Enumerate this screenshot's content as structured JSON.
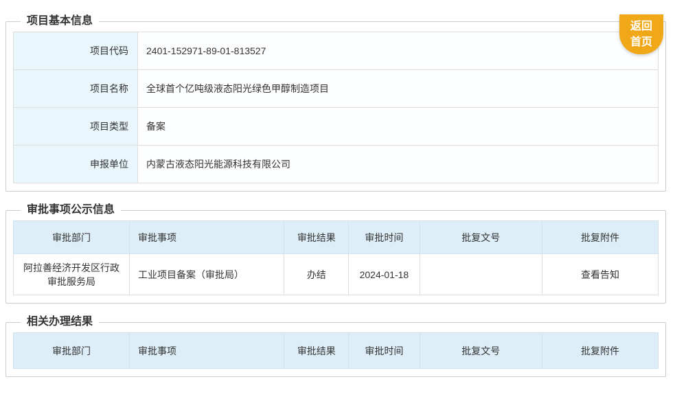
{
  "back_button": {
    "line1": "返回",
    "line2": "首页"
  },
  "colors": {
    "accent_orange": "#f0a818",
    "table_header_bg": "#ddeef8",
    "label_cell_bg": "#e9f6fc",
    "cell_border": "#dddddd",
    "panel_border": "#cccccc",
    "text": "#333333"
  },
  "basic_info": {
    "title": "项目基本信息",
    "fields": [
      {
        "label": "项目代码",
        "value": "2401-152971-89-01-813527"
      },
      {
        "label": "项目名称",
        "value": "全球首个亿吨级液态阳光绿色甲醇制造项目"
      },
      {
        "label": "项目类型",
        "value": "备案"
      },
      {
        "label": "申报单位",
        "value": "内蒙古液态阳光能源科技有限公司"
      }
    ]
  },
  "approval_info": {
    "title": "审批事项公示信息",
    "columns": [
      "审批部门",
      "审批事项",
      "审批结果",
      "审批时间",
      "批复文号",
      "批复附件"
    ],
    "rows": [
      [
        "阿拉善经济开发区行政审批服务局",
        "工业项目备案（审批局）",
        "办结",
        "2024-01-18",
        "",
        "查看告知"
      ]
    ]
  },
  "related_results": {
    "title": "相关办理结果",
    "columns": [
      "审批部门",
      "审批事项",
      "审批结果",
      "审批时间",
      "批复文号",
      "批复附件"
    ],
    "rows": []
  }
}
